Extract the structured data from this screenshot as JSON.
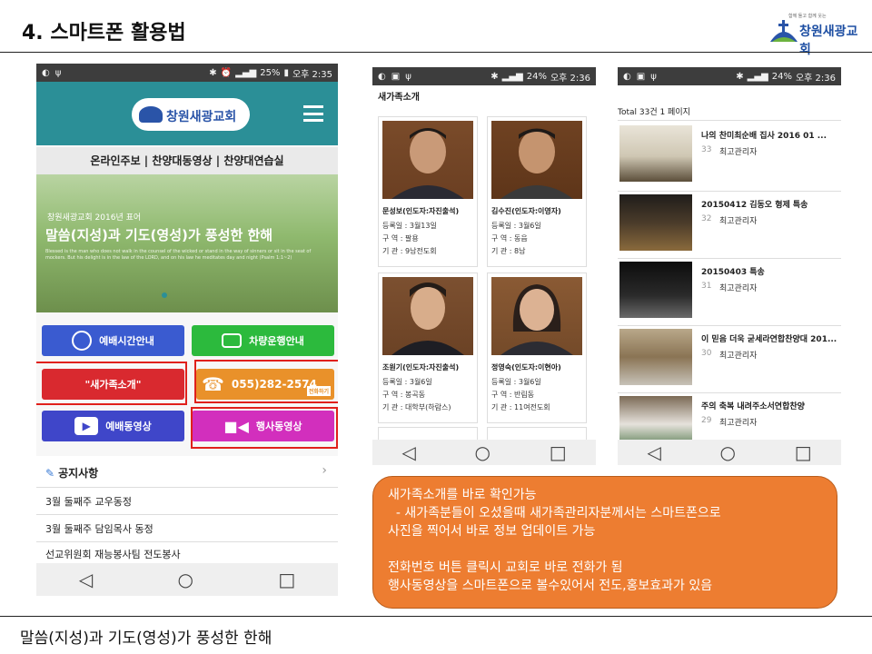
{
  "slide": {
    "title": "4. 스마트폰 활용법",
    "footer": "말씀(지성)과 기도(영성)가 풍성한 한해",
    "logo_text": "창원새광교회",
    "logo_tagline": "함께 돌고 함께 웃는"
  },
  "phone1": {
    "status_battery": "25%",
    "status_time": "오후 2:35",
    "church_name": "창원새광교회",
    "links": "온라인주보 | 찬양대동영상 | 찬양대연습실",
    "banner": {
      "sub": "창원새광교회 2016년 표어",
      "main": "말씀(지성)과 기도(영성)가 풍성한 한해",
      "verse": "Blessed is the man who does not walk in the counsel of the wicked or stand in the way of sinners or sit in the seat of mockers. But his delight is in the law of the LORD, and on his law he meditates day and night (Psalm 1:1~2)"
    },
    "buttons": {
      "worship_time": "예배시간안내",
      "vehicle": "차량운행안내",
      "new_family": "\"새가족소개\"",
      "phone": "055)282-2574",
      "call": "전화하기",
      "worship_video": "예배동영상",
      "event_video": "행사동영상"
    },
    "notice": {
      "heading": "공지사항",
      "items": [
        "3월 둘째주 교우동정",
        "3월 둘째주 담임목사 동정",
        "선교위원회 재능봉사팀 전도봉사"
      ]
    }
  },
  "phone2": {
    "status_battery": "24%",
    "status_time": "오후 2:36",
    "title": "새가족소개",
    "cards": [
      {
        "name": "문성보(인도자:자진출석)",
        "reg": "등록일 : 3월13일",
        "area": "구  역 : 팔용",
        "org": "기  관 : 9남전도회"
      },
      {
        "name": "김수진(인도자:이영자)",
        "reg": "등록일 : 3월6일",
        "area": "구  역 : 동읍",
        "org": "기  관 : 8남"
      },
      {
        "name": "조원기(인도자:자진출석)",
        "reg": "등록일 : 3월6일",
        "area": "구  역 : 봉곡동",
        "org": "기  관 : 대학부(하람스)"
      },
      {
        "name": "정영숙(인도자:이현아)",
        "reg": "등록일 : 3월6일",
        "area": "구  역 : 반림동",
        "org": "기  관 : 11여전도회"
      }
    ]
  },
  "phone3": {
    "status_battery": "24%",
    "status_time": "오후 2:36",
    "total": "Total 33건 1 페이지",
    "items": [
      {
        "title": "나의 찬미최순배 집사 2016 01 ...",
        "num": "33",
        "author": "최고관리자"
      },
      {
        "title": "20150412 김동오 형제 특송",
        "num": "32",
        "author": "최고관리자"
      },
      {
        "title": "20150403 특송",
        "num": "31",
        "author": "최고관리자"
      },
      {
        "title": "이 믿음 더욱 굳세라연합찬양대 201...",
        "num": "30",
        "author": "최고관리자"
      },
      {
        "title": "주의 축복 내려주소서연합찬양",
        "num": "29",
        "author": "최고관리자"
      }
    ]
  },
  "callout": {
    "lines": [
      "새가족소개를 바로 확인가능",
      "  - 새가족분들이 오셨을때 새가족관리자분께서는 스마트폰으로",
      "사진을 찍어서 바로 정보 업데이트 가능",
      "",
      "전화번호 버튼 클릭시 교회로 바로 전화가 됨",
      "행사동영상을 스마트폰으로 볼수있어서 전도,홍보효과가 있음"
    ]
  },
  "colors": {
    "header_teal": "#2b8f97",
    "callout_orange": "#ed7d31",
    "highlight_red": "#e0201b"
  }
}
